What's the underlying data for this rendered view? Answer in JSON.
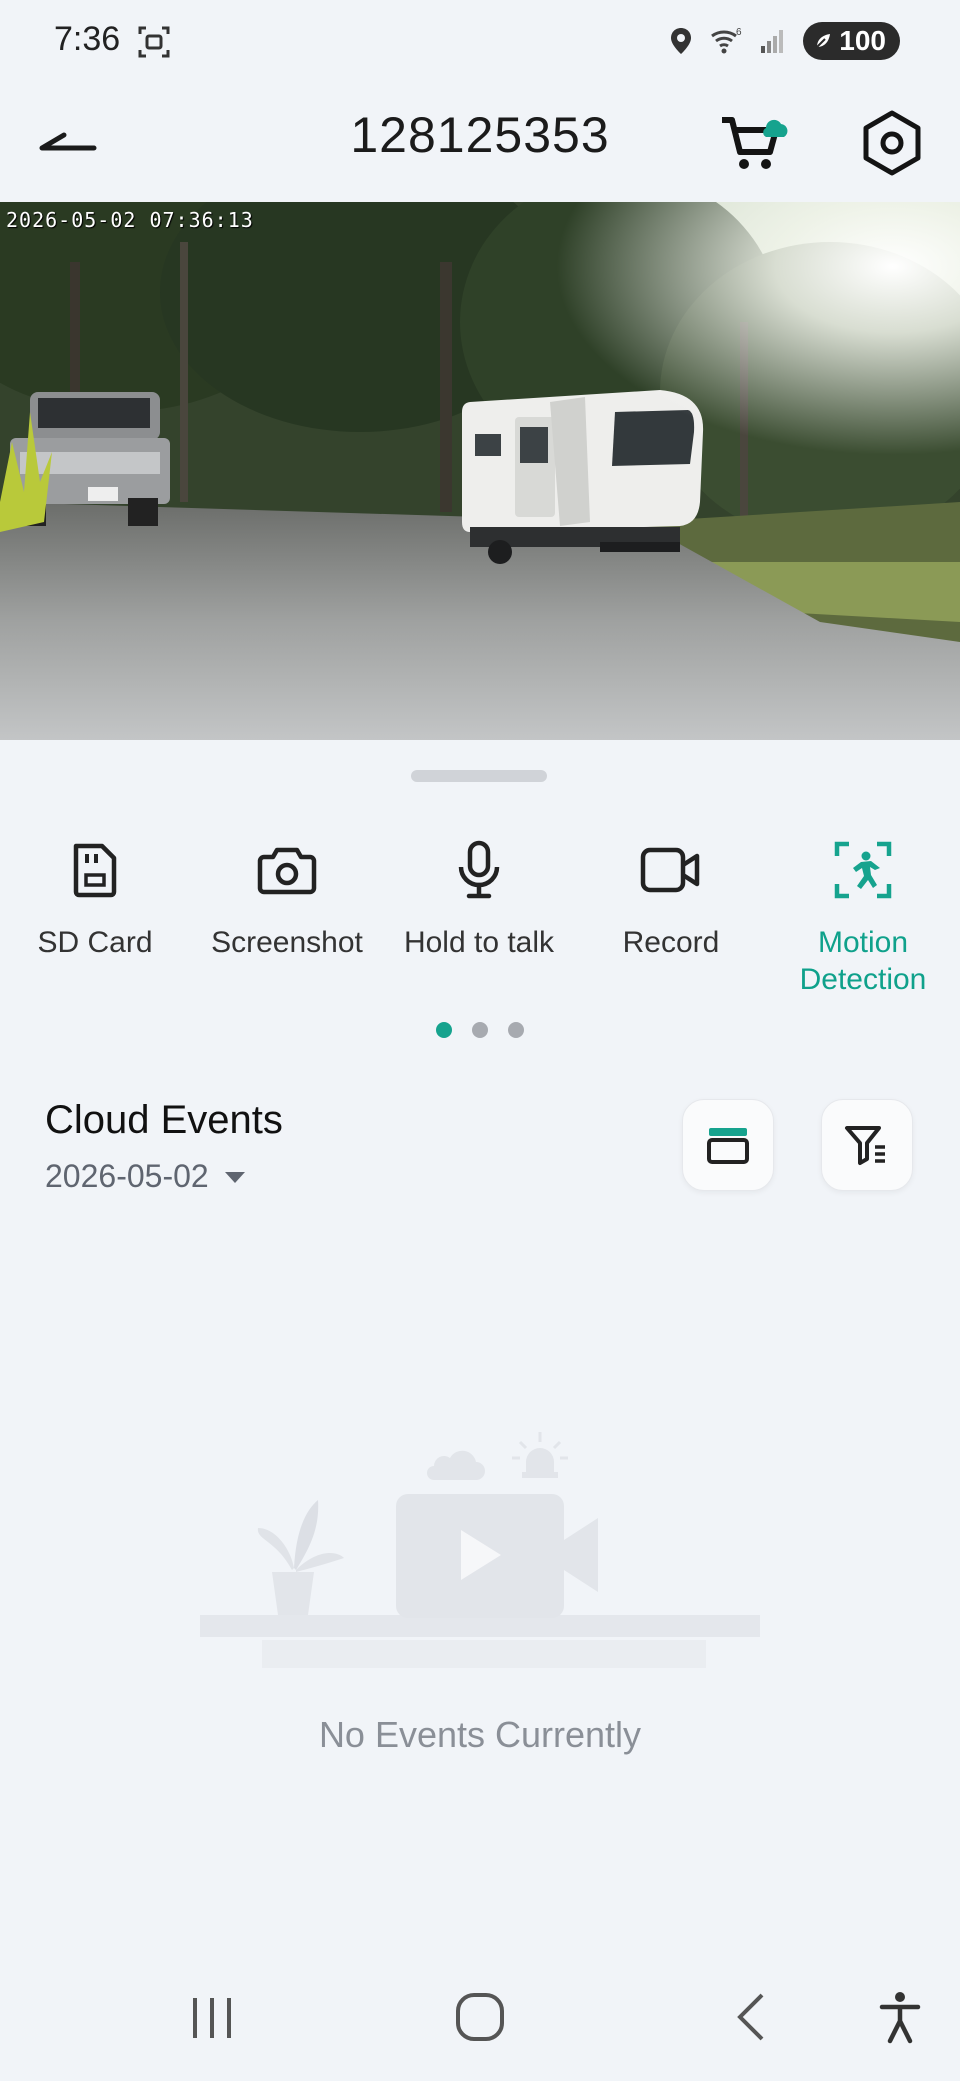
{
  "status_bar": {
    "time": "7:36",
    "battery": "100"
  },
  "header": {
    "title": "128125353"
  },
  "video": {
    "timestamp": "2026-05-02 07:36:13"
  },
  "controls": [
    {
      "label": "SD Card",
      "icon": "sd-card-icon",
      "active": false
    },
    {
      "label": "Screenshot",
      "icon": "camera-icon",
      "active": false
    },
    {
      "label": "Hold to talk",
      "icon": "microphone-icon",
      "active": false
    },
    {
      "label": "Record",
      "icon": "video-camera-icon",
      "active": false
    },
    {
      "label": "Motion\nDetection",
      "icon": "motion-detection-icon",
      "active": true
    }
  ],
  "pager": {
    "total": 3,
    "current": 1
  },
  "events": {
    "title": "Cloud Events",
    "date": "2026-05-02",
    "empty_text": "No Events Currently"
  },
  "colors": {
    "accent": "#16a38e",
    "background": "#f1f4f8"
  }
}
